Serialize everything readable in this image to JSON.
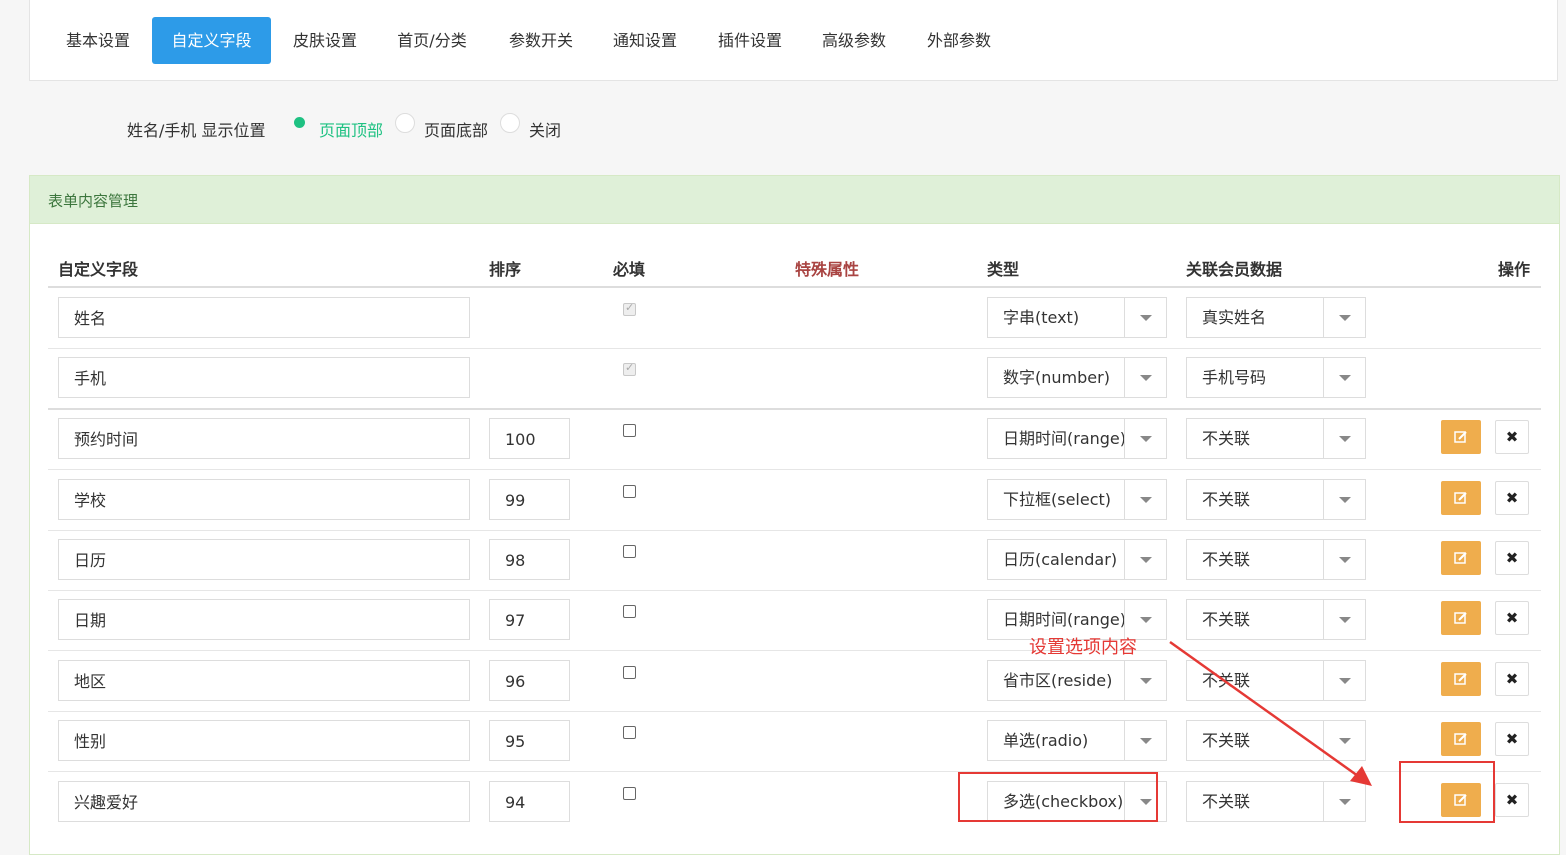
{
  "tabs": [
    "基本设置",
    "自定义字段",
    "皮肤设置",
    "首页/分类",
    "参数开关",
    "通知设置",
    "插件设置",
    "高级参数",
    "外部参数"
  ],
  "active_tab": "自定义字段",
  "display_setting": {
    "label": "姓名/手机 显示位置",
    "options": [
      "页面顶部",
      "页面底部",
      "关闭"
    ],
    "selected": "页面顶部"
  },
  "panel": {
    "title": "表单内容管理",
    "columns": {
      "field": "自定义字段",
      "order": "排序",
      "required": "必填",
      "special": "特殊属性",
      "type": "类型",
      "link": "关联会员数据",
      "action": "操作"
    },
    "rows": [
      {
        "field": "姓名",
        "order": "",
        "required": true,
        "required_disabled": true,
        "type": "字串(text)",
        "link": "真实姓名",
        "actions": false
      },
      {
        "field": "手机",
        "order": "",
        "required": true,
        "required_disabled": true,
        "type": "数字(number)",
        "link": "手机号码",
        "actions": false
      },
      {
        "field": "预约时间",
        "order": "100",
        "required": false,
        "type": "日期时间(range)",
        "link": "不关联",
        "actions": true
      },
      {
        "field": "学校",
        "order": "99",
        "required": false,
        "type": "下拉框(select)",
        "link": "不关联",
        "actions": true
      },
      {
        "field": "日历",
        "order": "98",
        "required": false,
        "type": "日历(calendar)",
        "link": "不关联",
        "actions": true
      },
      {
        "field": "日期",
        "order": "97",
        "required": false,
        "type": "日期时间(range)",
        "link": "不关联",
        "actions": true
      },
      {
        "field": "地区",
        "order": "96",
        "required": false,
        "type": "省市区(reside)",
        "link": "不关联",
        "actions": true
      },
      {
        "field": "性别",
        "order": "95",
        "required": false,
        "type": "单选(radio)",
        "link": "不关联",
        "actions": true
      },
      {
        "field": "兴趣爱好",
        "order": "94",
        "required": false,
        "type": "多选(checkbox)",
        "link": "不关联",
        "actions": true
      }
    ]
  },
  "annotation": {
    "text": "设置选项内容",
    "color": "#e53935"
  },
  "colors": {
    "tab_active": "#2d9be8",
    "radio_checked": "#1ec182",
    "panel_head_bg": "#dff0d8",
    "panel_title": "#3c763d",
    "special_header": "#a94442",
    "edit_button": "#efad4d"
  },
  "icons": {
    "edit": "edit-icon",
    "delete": "close-icon",
    "dropdown": "caret-down-icon"
  }
}
